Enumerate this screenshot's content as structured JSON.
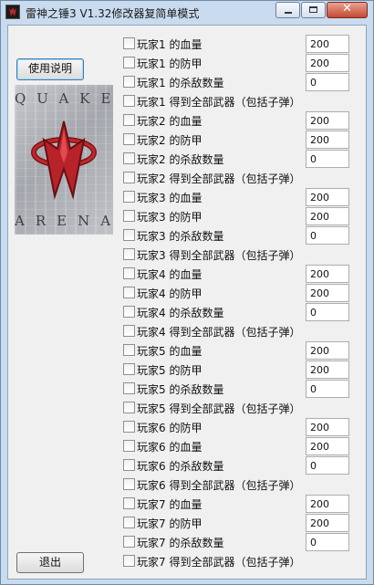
{
  "window": {
    "title": "雷神之锤3 V1.32修改器复简单模式"
  },
  "buttons": {
    "help": "使用说明",
    "exit": "退出"
  },
  "logo": {
    "top_text": "QUAKE",
    "bottom_text": "ARENA"
  },
  "cheats": [
    {
      "label": "玩家1 的血量",
      "value": "200"
    },
    {
      "label": "玩家1 的防甲",
      "value": "200"
    },
    {
      "label": "玩家1 的杀敌数量",
      "value": "0"
    },
    {
      "label": "玩家1 得到全部武器（包括子弹）",
      "value": null
    },
    {
      "label": "玩家2 的血量",
      "value": "200"
    },
    {
      "label": "玩家2 的防甲",
      "value": "200"
    },
    {
      "label": "玩家2 的杀敌数量",
      "value": "0"
    },
    {
      "label": "玩家2 得到全部武器（包括子弹）",
      "value": null
    },
    {
      "label": "玩家3 的血量",
      "value": "200"
    },
    {
      "label": "玩家3 的防甲",
      "value": "200"
    },
    {
      "label": "玩家3 的杀敌数量",
      "value": "0"
    },
    {
      "label": "玩家3 得到全部武器（包括子弹）",
      "value": null
    },
    {
      "label": "玩家4 的血量",
      "value": "200"
    },
    {
      "label": "玩家4 的防甲",
      "value": "200"
    },
    {
      "label": "玩家4 的杀敌数量",
      "value": "0"
    },
    {
      "label": "玩家4 得到全部武器（包括子弹）",
      "value": null
    },
    {
      "label": "玩家5 的血量",
      "value": "200"
    },
    {
      "label": "玩家5 的防甲",
      "value": "200"
    },
    {
      "label": "玩家5 的杀敌数量",
      "value": "0"
    },
    {
      "label": "玩家5 得到全部武器（包括子弹）",
      "value": null
    },
    {
      "label": "玩家6 的防甲",
      "value": "200"
    },
    {
      "label": "玩家6 的血量",
      "value": "200"
    },
    {
      "label": "玩家6 的杀敌数量",
      "value": "0"
    },
    {
      "label": "玩家6 得到全部武器（包括子弹）",
      "value": null
    },
    {
      "label": "玩家7 的血量",
      "value": "200"
    },
    {
      "label": "玩家7 的防甲",
      "value": "200"
    },
    {
      "label": "玩家7 的杀敌数量",
      "value": "0"
    },
    {
      "label": "玩家7 得到全部武器（包括子弹）",
      "value": null
    }
  ]
}
